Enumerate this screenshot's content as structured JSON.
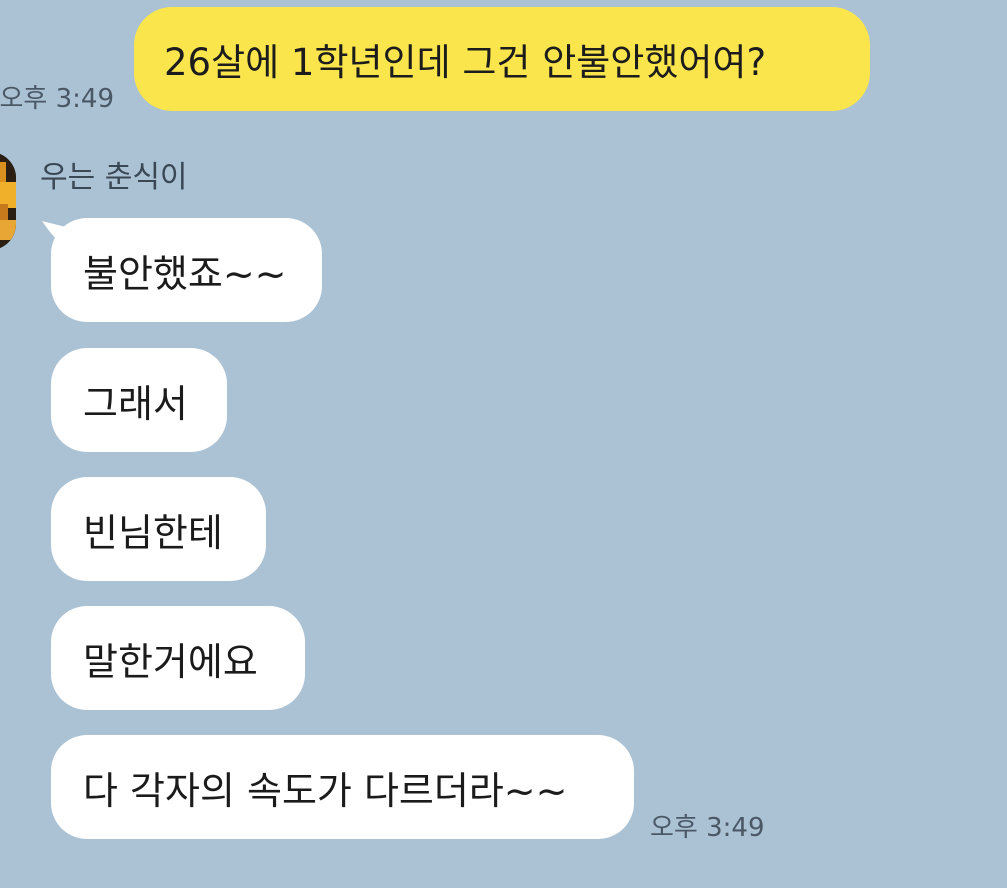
{
  "outgoing": {
    "text": "26살에 1학년인데 그건 안불안했어여?",
    "time": "오후 3:49"
  },
  "incoming": {
    "sender": "우는 춘식이",
    "messages": [
      "불안했죠~~",
      "그래서",
      "빈님한테",
      "말한거에요",
      "다 각자의 속도가 다르더라~~"
    ],
    "time": "오후 3:49"
  },
  "colors": {
    "background": "#abc1d4",
    "outgoing_bubble": "#fae64c",
    "incoming_bubble": "#ffffff"
  }
}
